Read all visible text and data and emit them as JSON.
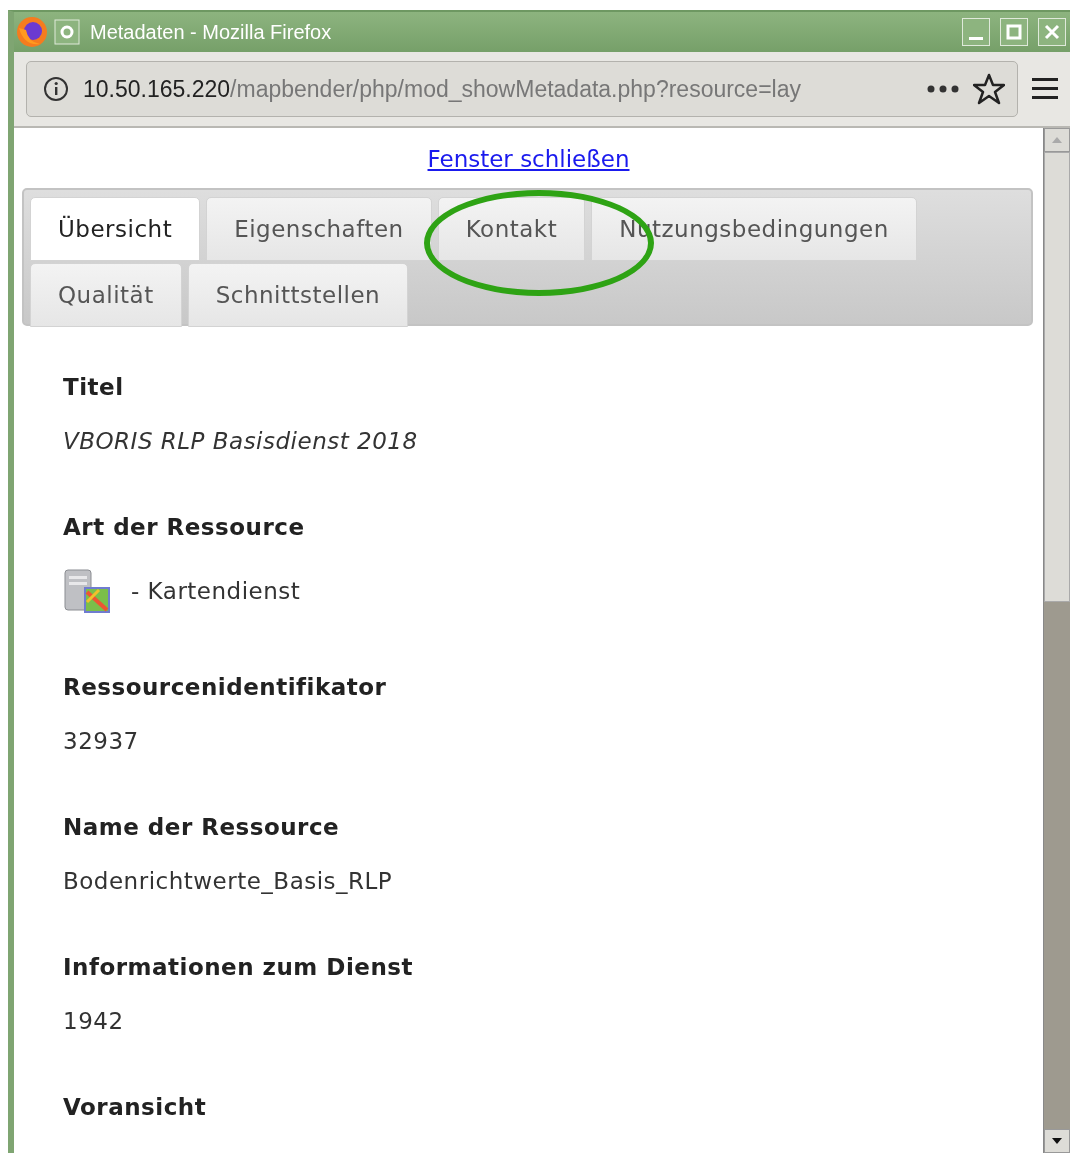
{
  "window": {
    "title": "Metadaten - Mozilla Firefox"
  },
  "address_bar": {
    "host": "10.50.165.220",
    "path": "/mapbender/php/mod_showMetadata.php?resource=lay"
  },
  "close_link": "Fenster schließen",
  "tabs": [
    {
      "label": "Übersicht",
      "selected": true,
      "highlighted": false
    },
    {
      "label": "Eigenschaften",
      "selected": false,
      "highlighted": false
    },
    {
      "label": "Kontakt",
      "selected": false,
      "highlighted": true
    },
    {
      "label": "Nutzungsbedingungen",
      "selected": false,
      "highlighted": false
    },
    {
      "label": "Qualität",
      "selected": false,
      "highlighted": false
    },
    {
      "label": "Schnittstellen",
      "selected": false,
      "highlighted": false
    }
  ],
  "sections": [
    {
      "heading": "Titel",
      "value": "VBORIS RLP Basisdienst 2018",
      "kind": "italic"
    },
    {
      "heading": "Art der Ressource",
      "value": "- Kartendienst",
      "kind": "icon"
    },
    {
      "heading": "Ressourcenidentifikator",
      "value": "32937",
      "kind": "plain"
    },
    {
      "heading": "Name der Ressource",
      "value": "Bodenrichtwerte_Basis_RLP",
      "kind": "plain"
    },
    {
      "heading": "Informationen zum Dienst",
      "value": "1942",
      "kind": "plain"
    },
    {
      "heading": "Voransicht",
      "kind": "plain"
    }
  ]
}
